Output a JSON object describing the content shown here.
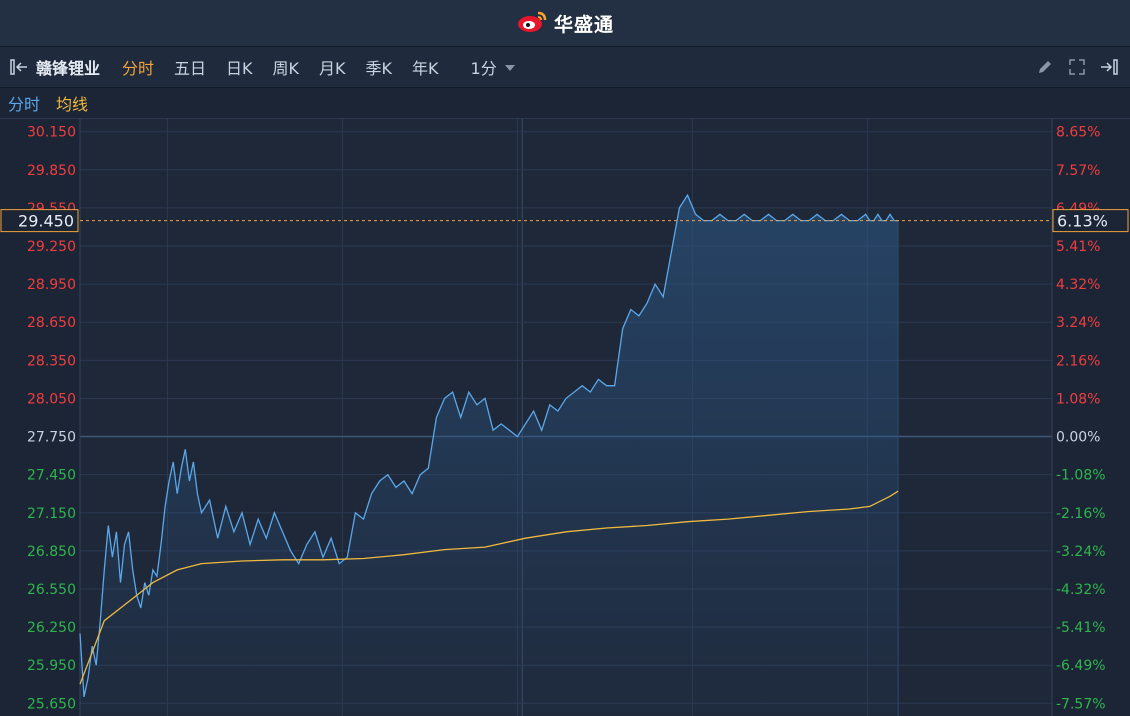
{
  "app": {
    "brand": "华盛通"
  },
  "toolbar": {
    "stock_name": "赣锋锂业",
    "tabs": [
      "分时",
      "五日",
      "日K",
      "周K",
      "月K",
      "季K",
      "年K"
    ],
    "active_tab": 0,
    "interval": "1分"
  },
  "legend": {
    "minute_label": "分时",
    "avg_label": "均线"
  },
  "colors": {
    "up": "#f23d3d",
    "down": "#2fb54c",
    "price_line": "#5aa8ea",
    "avg_line": "#f0b93e",
    "accent": "#f2a33a"
  },
  "chart_data": {
    "type": "line",
    "base_price": 27.75,
    "current_price": "29.450",
    "current_change": "6.13%",
    "y_ticks": [
      "30.150",
      "29.850",
      "29.550",
      "29.250",
      "28.950",
      "28.650",
      "28.350",
      "28.050",
      "27.750",
      "27.450",
      "27.150",
      "26.850",
      "26.550",
      "26.250",
      "25.950",
      "25.650"
    ],
    "y_tick_values": [
      30.15,
      29.85,
      29.55,
      29.25,
      28.95,
      28.65,
      28.35,
      28.05,
      27.75,
      27.45,
      27.15,
      26.85,
      26.55,
      26.25,
      25.95,
      25.65
    ],
    "pct_ticks": [
      "8.65%",
      "7.57%",
      "6.49%",
      "5.41%",
      "4.32%",
      "3.24%",
      "2.16%",
      "1.08%",
      "0.00%",
      "-1.08%",
      "-2.16%",
      "-3.24%",
      "-4.32%",
      "-5.41%",
      "-6.49%",
      "-7.57%"
    ],
    "ylim": [
      25.55,
      30.25
    ],
    "total_minutes": 240,
    "price_series": {
      "minutes": [
        0,
        1,
        2,
        3,
        4,
        5,
        6,
        7,
        8,
        9,
        10,
        11,
        12,
        13,
        14,
        15,
        16,
        17,
        18,
        19,
        20,
        21,
        22,
        23,
        24,
        25,
        26,
        27,
        28,
        29,
        30,
        32,
        34,
        36,
        38,
        40,
        42,
        44,
        46,
        48,
        50,
        52,
        54,
        56,
        58,
        60,
        62,
        64,
        66,
        68,
        70,
        72,
        74,
        76,
        78,
        80,
        82,
        84,
        86,
        88,
        90,
        92,
        94,
        96,
        98,
        100,
        102,
        104,
        106,
        108,
        110,
        112,
        114,
        116,
        118,
        120,
        122,
        124,
        126,
        128,
        130,
        132,
        134,
        136,
        138,
        140,
        142,
        144,
        146,
        148,
        150,
        152,
        154,
        156,
        158,
        160,
        162,
        164,
        166,
        168,
        170,
        172,
        174,
        176,
        178,
        180,
        182,
        184,
        186,
        188,
        190,
        192,
        194,
        195,
        196,
        197,
        198,
        199,
        200,
        201,
        202
      ],
      "values": [
        26.2,
        25.7,
        25.85,
        26.1,
        25.95,
        26.3,
        26.7,
        27.05,
        26.8,
        27.0,
        26.6,
        26.9,
        27.0,
        26.7,
        26.5,
        26.4,
        26.6,
        26.5,
        26.7,
        26.65,
        26.9,
        27.2,
        27.4,
        27.55,
        27.3,
        27.5,
        27.65,
        27.4,
        27.55,
        27.3,
        27.15,
        27.25,
        26.95,
        27.2,
        27.0,
        27.15,
        26.9,
        27.1,
        26.95,
        27.15,
        27.0,
        26.85,
        26.75,
        26.9,
        27.0,
        26.8,
        26.95,
        26.75,
        26.8,
        27.15,
        27.1,
        27.3,
        27.4,
        27.45,
        27.35,
        27.4,
        27.3,
        27.45,
        27.5,
        27.9,
        28.05,
        28.1,
        27.9,
        28.1,
        28.0,
        28.05,
        27.8,
        27.85,
        27.8,
        27.75,
        27.85,
        27.95,
        27.8,
        28.0,
        27.95,
        28.05,
        28.1,
        28.15,
        28.1,
        28.2,
        28.15,
        28.15,
        28.6,
        28.75,
        28.7,
        28.8,
        28.95,
        28.85,
        29.2,
        29.55,
        29.65,
        29.5,
        29.45,
        29.45,
        29.5,
        29.45,
        29.45,
        29.5,
        29.45,
        29.45,
        29.5,
        29.45,
        29.45,
        29.5,
        29.45,
        29.45,
        29.5,
        29.45,
        29.45,
        29.5,
        29.45,
        29.45,
        29.5,
        29.45,
        29.45,
        29.5,
        29.45,
        29.45,
        29.5,
        29.45,
        29.45
      ]
    },
    "avg_series": {
      "minutes": [
        0,
        6,
        12,
        18,
        24,
        30,
        40,
        50,
        60,
        70,
        80,
        90,
        100,
        110,
        120,
        130,
        140,
        150,
        160,
        170,
        180,
        190,
        195,
        200,
        202
      ],
      "values": [
        25.8,
        26.3,
        26.45,
        26.6,
        26.7,
        26.75,
        26.77,
        26.78,
        26.78,
        26.79,
        26.82,
        26.86,
        26.88,
        26.95,
        27.0,
        27.03,
        27.05,
        27.08,
        27.1,
        27.13,
        27.16,
        27.18,
        27.2,
        27.28,
        27.32
      ]
    }
  }
}
